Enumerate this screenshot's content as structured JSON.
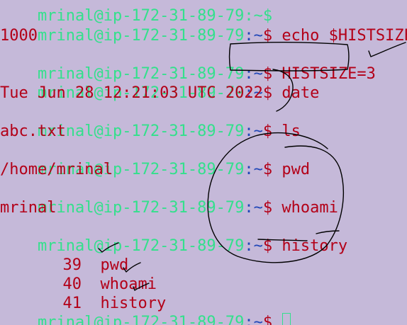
{
  "prompt": {
    "user_host": "mrinal@ip-172-31-89-79",
    "separator": ":",
    "path": "~",
    "symbol": "$ "
  },
  "top_partial_prompt": "mrinal@ip-172-31-89-79:~$",
  "lines": [
    {
      "command": "echo $HISTSIZE"
    },
    {
      "output": "1000"
    },
    {
      "command": "HISTSIZE=3"
    },
    {
      "command": "date"
    },
    {
      "output": "Tue Jun 28 12:21:03 UTC 2022"
    },
    {
      "command": "ls"
    },
    {
      "output": "abc.txt"
    },
    {
      "command": "pwd"
    },
    {
      "output": "/home/mrinal"
    },
    {
      "command": "whoami"
    },
    {
      "output": "mrinal"
    },
    {
      "command": "history"
    }
  ],
  "history": [
    {
      "num": "39",
      "cmd": "pwd"
    },
    {
      "num": "40",
      "cmd": "whoami"
    },
    {
      "num": "41",
      "cmd": "history"
    }
  ],
  "colors": {
    "background": "#c5b9d9",
    "prompt_user": "#33e08c",
    "prompt_path": "#1f46b8",
    "text": "#b30018",
    "annotation_ink": "#000000"
  }
}
